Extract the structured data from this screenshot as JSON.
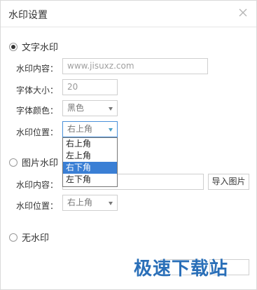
{
  "dialog": {
    "title": "水印设置"
  },
  "text_watermark": {
    "radio_label": "文字水印",
    "content_label": "水印内容：",
    "content_placeholder": "www.jisuxz.com",
    "font_size_label": "字体大小：",
    "font_size_value": "20",
    "font_color_label": "字体颜色：",
    "font_color_value": "黑色",
    "position_label": "水印位置：",
    "position_value": "右上角",
    "position_options": [
      "右上角",
      "左上角",
      "右下角",
      "左下角"
    ],
    "highlighted_option": "右下角"
  },
  "image_watermark": {
    "radio_label": "图片水印",
    "content_label": "水印内容：",
    "import_button": "导入图片",
    "position_label": "水印位置：",
    "position_value": "右上角"
  },
  "no_watermark": {
    "radio_label": "无水印"
  },
  "footer": {
    "brand_text": "极速下载站"
  },
  "colors": {
    "highlight": "#3a7fd5",
    "brand": "#2a6fb8"
  }
}
